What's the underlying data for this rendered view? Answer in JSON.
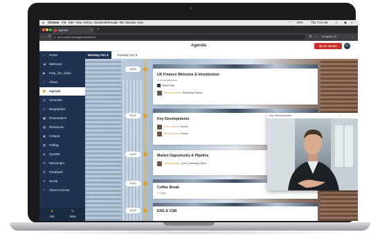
{
  "menubar": {
    "items": [
      "Chrome",
      "File",
      "Edit",
      "View",
      "History",
      "Bookmarks",
      "People",
      "Tab",
      "Window",
      "Help"
    ],
    "battery": "93%",
    "clock": "Thu 7:44 AM"
  },
  "browser": {
    "tab_title": "Agenda",
    "tab_close": "×",
    "new_tab": "+",
    "url": "uk-fi.chime.live/app/hub/sabe/4",
    "profile": "Incognito (2)"
  },
  "app": {
    "title": "Agenda",
    "livestream_label": "Live stream",
    "avatar_initials": "EE"
  },
  "sidebar": {
    "items": [
      {
        "label": "Home",
        "icon": "house-icon",
        "glyph": "⌂"
      },
      {
        "label": "Welcome",
        "icon": "megaphone-icon",
        "glyph": "◀"
      },
      {
        "label": "Help_live_video",
        "icon": "video-icon",
        "glyph": "▶"
      },
      {
        "label": "About",
        "icon": "info-icon",
        "glyph": "i"
      },
      {
        "label": "Agenda",
        "icon": "calendar-icon",
        "glyph": "▦"
      },
      {
        "label": "Schedule",
        "icon": "clock-icon",
        "glyph": "◷"
      },
      {
        "label": "Biographies",
        "icon": "people-icon",
        "glyph": "☺"
      },
      {
        "label": "Presentation",
        "icon": "presentation-icon",
        "glyph": "▣"
      },
      {
        "label": "Resources",
        "icon": "folder-icon",
        "glyph": "▤"
      },
      {
        "label": "Hotspot",
        "icon": "pin-icon",
        "glyph": "◉"
      },
      {
        "label": "Polling",
        "icon": "chart-icon",
        "glyph": "▥"
      },
      {
        "label": "Upvoter",
        "icon": "thumb-icon",
        "glyph": "▲"
      },
      {
        "label": "Messenger",
        "icon": "chat-icon",
        "glyph": "✉"
      },
      {
        "label": "Feedback",
        "icon": "feedback-icon",
        "glyph": "★"
      },
      {
        "label": "Social",
        "icon": "twitter-icon",
        "glyph": "♦"
      },
      {
        "label": "About Concise",
        "icon": "info-circle-icon",
        "glyph": "○"
      }
    ],
    "ask_label": "Ask",
    "note_label": "Note"
  },
  "days": [
    "Monday Oct 4",
    "Tuesday Oct 5"
  ],
  "agenda": {
    "times": [
      "08:00",
      "08:15",
      "09:00",
      "10:00",
      "10:00"
    ],
    "sessions": [
      {
        "title": "UK Finance Welcome & Introduction",
        "location": "Grand Ballroom",
        "venue_label": "Venue map",
        "speakers": [
          {
            "name": "Rebecca Jones",
            "role": "Managing Partner"
          }
        ]
      },
      {
        "title": "Key Developments",
        "speakers": [
          {
            "name": "Peter Stroker",
            "role": "Partner"
          },
          {
            "name": "Bill Lawrence",
            "role": "Partner"
          }
        ]
      },
      {
        "title": "Market Opportunity & Pipeline",
        "speakers": [
          {
            "name": "Sarah Mitchell",
            "role": "Chief Operating Officer"
          }
        ]
      },
      {
        "title": "Coffee Break",
        "location": "Foyer"
      },
      {
        "title": "ESG & CSR"
      }
    ]
  },
  "video": {
    "title": "Key Developments"
  },
  "colors": {
    "navy": "#1f3350",
    "accent": "#e3a127",
    "live": "#c9302c"
  }
}
